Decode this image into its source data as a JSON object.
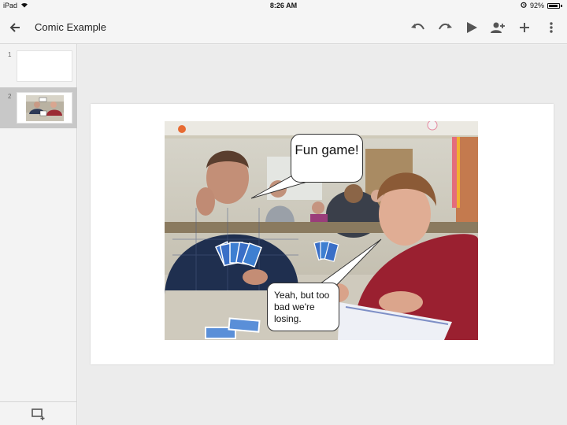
{
  "status_bar": {
    "device": "iPad",
    "time": "8:26 AM",
    "battery": "92%",
    "battery_level": 0.92
  },
  "toolbar": {
    "title": "Comic Example",
    "icons": [
      "back-arrow-icon",
      "undo-icon",
      "redo-icon",
      "present-play-icon",
      "add-person-icon",
      "insert-plus-icon",
      "more-vert-icon"
    ]
  },
  "sidebar": {
    "slides": [
      {
        "number": "1"
      },
      {
        "number": "2",
        "selected": true
      }
    ],
    "add_slide_icon": "add-slide-icon"
  },
  "slide": {
    "bubble_top": "Fun game!",
    "bubble_bottom": "Yeah, but too bad we're losing."
  },
  "colors": {
    "toolbar_bg": "#f5f5f5",
    "selected_thumb": "#c8c8c8",
    "canvas_bg": "#ececec"
  }
}
